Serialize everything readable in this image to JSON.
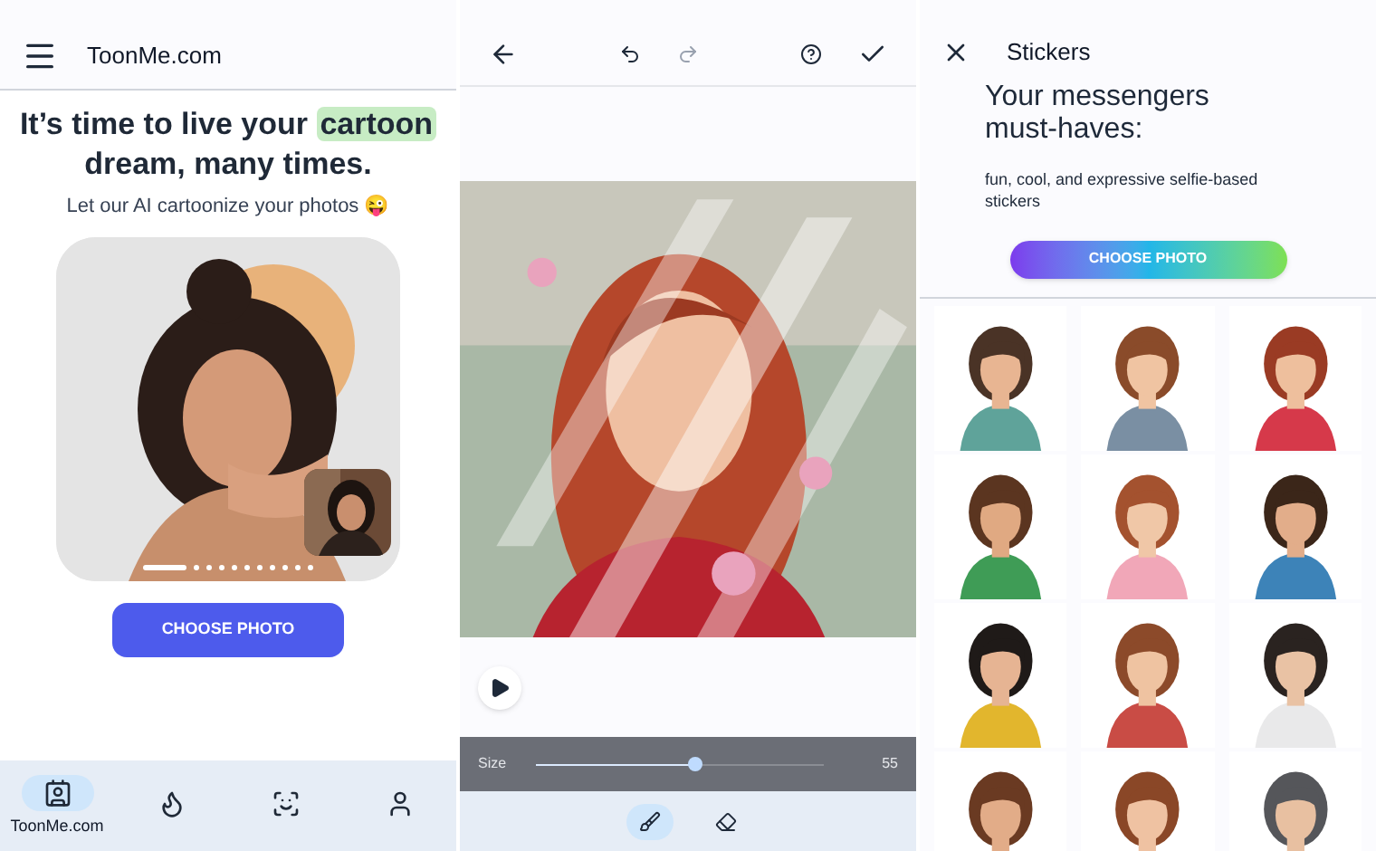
{
  "home": {
    "title": "ToonMe.com",
    "headline": {
      "before": "It’s time to live your ",
      "highlight": "cartoon",
      "after": " dream, many times."
    },
    "subtitle": "Let our AI cartoonize your photos 😜",
    "carousel": [
      {
        "selected": true
      },
      {
        "selected": false
      },
      {
        "selected": false
      },
      {
        "selected": false
      },
      {
        "selected": false
      },
      {
        "selected": false
      },
      {
        "selected": false
      },
      {
        "selected": false
      },
      {
        "selected": false
      },
      {
        "selected": false
      },
      {
        "selected": false
      }
    ],
    "button": "CHOOSE PHOTO",
    "nav": [
      {
        "label": "ToonMe.com",
        "selected": true
      },
      {
        "selected": false
      },
      {
        "selected": false
      },
      {
        "selected": false
      }
    ]
  },
  "editor": {
    "undo": {
      "disabled": false
    },
    "redo": {
      "disabled": true
    },
    "slider": {
      "label": "Size",
      "level": 0.55,
      "reading": "55"
    },
    "tools": [
      {
        "selected": true
      },
      {
        "selected": false
      }
    ]
  },
  "stickers": {
    "title": "Stickers",
    "heading": "Your messengers must-haves:",
    "description": "fun, cool, and expressive selfie-based stickers",
    "button": "CHOOSE PHOTO"
  }
}
